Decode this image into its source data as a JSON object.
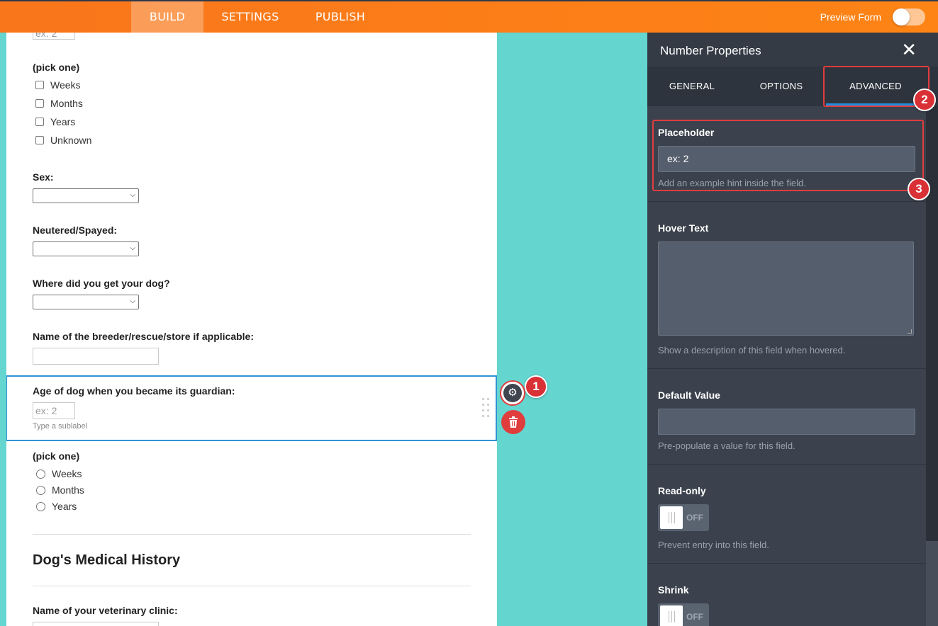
{
  "topbar": {
    "tabs": [
      "BUILD",
      "SETTINGS",
      "PUBLISH"
    ],
    "active_tab": "BUILD",
    "preview_label": "Preview Form",
    "preview_on": false
  },
  "form": {
    "top_input_placeholder": "ex: 2",
    "pick_one_label_1": "(pick one)",
    "checkbox_options": [
      "Weeks",
      "Months",
      "Years",
      "Unknown"
    ],
    "sex_label": "Sex:",
    "neutered_label": "Neutered/Spayed:",
    "where_label": "Where did you get your dog?",
    "breeder_label": "Name of the breeder/rescue/store if applicable:",
    "age_label": "Age of dog when you became its guardian:",
    "age_placeholder": "ex: 2",
    "age_sublabel": "Type a sublabel",
    "pick_one_label_2": "(pick one)",
    "radio_options": [
      "Weeks",
      "Months",
      "Years"
    ],
    "section_heading": "Dog's Medical History",
    "vet_label": "Name of your veterinary clinic:"
  },
  "annotations": {
    "badge_1": "1",
    "badge_2": "2",
    "badge_3": "3",
    "accent_color": "#e03d3d"
  },
  "panel": {
    "title": "Number Properties",
    "tabs": [
      "GENERAL",
      "OPTIONS",
      "ADVANCED"
    ],
    "active_tab": "ADVANCED",
    "placeholder": {
      "label": "Placeholder",
      "value": "ex: 2",
      "help": "Add an example hint inside the field."
    },
    "hover_text": {
      "label": "Hover Text",
      "help": "Show a description of this field when hovered."
    },
    "default_value": {
      "label": "Default Value",
      "help": "Pre-populate a value for this field."
    },
    "read_only": {
      "label": "Read-only",
      "state": "OFF",
      "help": "Prevent entry into this field."
    },
    "shrink": {
      "label": "Shrink",
      "state": "OFF"
    }
  },
  "colors": {
    "topbar": "#fd8415",
    "canvas_bg": "#64d5cf",
    "panel_bg": "#3b424d",
    "tab_underline": "#1e8fe1",
    "selected_border": "#2f92d6"
  }
}
